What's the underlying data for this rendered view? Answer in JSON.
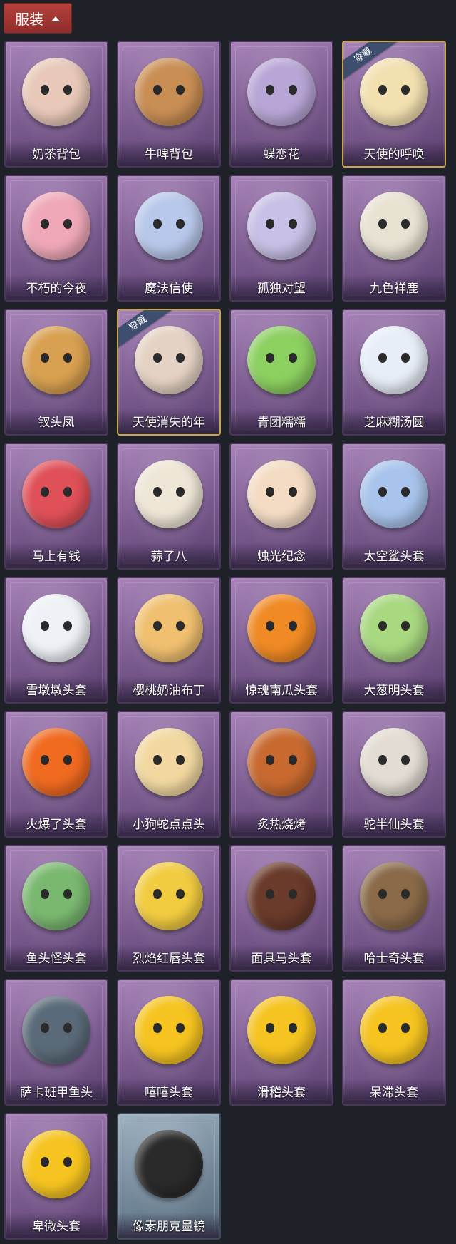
{
  "header": {
    "title": "服装",
    "toggle_icon": "chevron-up-icon"
  },
  "badge_text": "穿戴",
  "items": [
    {
      "name": "奶茶背包",
      "equipped": false,
      "color": "#e8c8b8"
    },
    {
      "name": "牛啤背包",
      "equipped": false,
      "color": "#c98e54"
    },
    {
      "name": "蝶恋花",
      "equipped": false,
      "color": "#b8a6d6"
    },
    {
      "name": "天使的呼唤",
      "equipped": true,
      "color": "#f3e0b0"
    },
    {
      "name": "不朽的今夜",
      "equipped": false,
      "color": "#f0a8b8"
    },
    {
      "name": "魔法信使",
      "equipped": false,
      "color": "#b8c8ea"
    },
    {
      "name": "孤独对望",
      "equipped": false,
      "color": "#c8c0e6"
    },
    {
      "name": "九色祥鹿",
      "equipped": false,
      "color": "#e8e2d2"
    },
    {
      "name": "钗头凤",
      "equipped": false,
      "color": "#d8a050"
    },
    {
      "name": "天使消失的年",
      "equipped": true,
      "color": "#e4d2c4"
    },
    {
      "name": "青团糯糯",
      "equipped": false,
      "color": "#8cd060"
    },
    {
      "name": "芝麻糊汤圆",
      "equipped": false,
      "color": "#e8eef8"
    },
    {
      "name": "马上有钱",
      "equipped": false,
      "color": "#e05058"
    },
    {
      "name": "蒜了八",
      "equipped": false,
      "color": "#eee6d6"
    },
    {
      "name": "烛光纪念",
      "equipped": false,
      "color": "#f4dcc4"
    },
    {
      "name": "太空鲨头套",
      "equipped": false,
      "color": "#a8c4ec"
    },
    {
      "name": "雪墩墩头套",
      "equipped": false,
      "color": "#eef2f6"
    },
    {
      "name": "樱桃奶油布丁",
      "equipped": false,
      "color": "#f0c070"
    },
    {
      "name": "惊魂南瓜头套",
      "equipped": false,
      "color": "#f08a24"
    },
    {
      "name": "大葱明头套",
      "equipped": false,
      "color": "#a8d880"
    },
    {
      "name": "火爆了头套",
      "equipped": false,
      "color": "#f06a20"
    },
    {
      "name": "小狗蛇点点头",
      "equipped": false,
      "color": "#f2d8a0"
    },
    {
      "name": "炙热烧烤",
      "equipped": false,
      "color": "#c86a30"
    },
    {
      "name": "驼半仙头套",
      "equipped": false,
      "color": "#e2dcd2"
    },
    {
      "name": "鱼头怪头套",
      "equipped": false,
      "color": "#7ab870"
    },
    {
      "name": "烈焰红唇头套",
      "equipped": false,
      "color": "#f2cc40"
    },
    {
      "name": "面具马头套",
      "equipped": false,
      "color": "#6a3a2a"
    },
    {
      "name": "哈士奇头套",
      "equipped": false,
      "color": "#8a6a48"
    },
    {
      "name": "萨卡班甲鱼头",
      "equipped": false,
      "color": "#5a6a78"
    },
    {
      "name": "嘻嘻头套",
      "equipped": false,
      "color": "#f6c420"
    },
    {
      "name": "滑稽头套",
      "equipped": false,
      "color": "#f6c420"
    },
    {
      "name": "呆滞头套",
      "equipped": false,
      "color": "#f6c420"
    },
    {
      "name": "卑微头套",
      "equipped": false,
      "color": "#f6c420"
    },
    {
      "name": "像素朋克墨镜",
      "equipped": false,
      "color": "#2a2a2a",
      "grey": true
    }
  ]
}
